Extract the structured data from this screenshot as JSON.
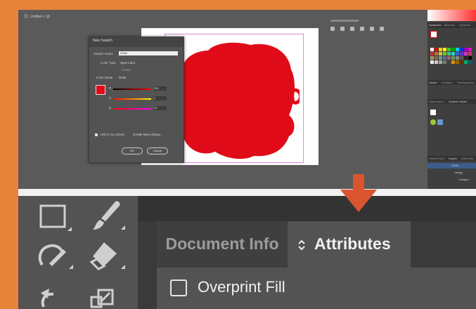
{
  "colors": {
    "frame": "#e8833a",
    "accent_arrow": "#d9542f",
    "red_fill": "#e00b19"
  },
  "top": {
    "tab_label": "Untitled-1 @",
    "dialog": {
      "title": "New Swatch",
      "swatch_name_label": "Swatch Name",
      "swatch_name_value": "White",
      "color_type_label": "Color Type",
      "color_type_value": "Spot Color",
      "global_label": "Global",
      "color_mode_label": "Color Mode",
      "color_mode_value": "RGB",
      "r_label": "R",
      "r_value": "255",
      "g_label": "G",
      "g_value": "0",
      "b_label": "B",
      "b_value": "28",
      "add_to_library_label": "Add to my Library",
      "library_value": "Create New Library...",
      "ok_label": "OK",
      "cancel_label": "Cancel"
    },
    "panel_tabs": [
      "Swatches",
      "Brushes",
      "Symbols"
    ],
    "panel_tabs2": [
      "Stroke",
      "Gradient",
      "Transparency"
    ],
    "panel_tabs3": [
      "Appearance",
      "Graphic Styles"
    ],
    "panel_tabs4": [
      "Asset Export",
      "Layers",
      "Artboards"
    ],
    "layers": [
      "White",
      "Design",
      "<Image>"
    ]
  },
  "bottom": {
    "tabs": {
      "doc_info": "Document Info",
      "attributes": "Attributes",
      "attributes_icon": "updown-chevron-icon"
    },
    "overprint_fill_label": "Overprint Fill"
  }
}
